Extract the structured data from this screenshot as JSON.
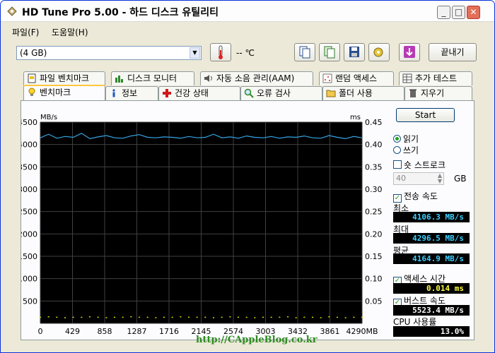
{
  "window": {
    "title": "HD Tune Pro 5.00 - 하드 디스크 유틸리티"
  },
  "menu": [
    {
      "label": "파일(F)"
    },
    {
      "label": "도움말(H)"
    }
  ],
  "toolbar": {
    "drive_value": "(4 GB)",
    "temperature": "-- ℃",
    "exit_label": "끝내기"
  },
  "tabs_top": [
    {
      "label": "파일 벤치마크"
    },
    {
      "label": "디스크 모니터"
    },
    {
      "label": "자동 소음 관리(AAM)"
    },
    {
      "label": "랜덤 액세스"
    },
    {
      "label": "추가 테스트"
    }
  ],
  "tabs_bottom": [
    {
      "label": "벤치마크"
    },
    {
      "label": "정보"
    },
    {
      "label": "건강 상태"
    },
    {
      "label": "오류 검사"
    },
    {
      "label": "폴더 사용"
    },
    {
      "label": "지우기"
    }
  ],
  "controls": {
    "start_label": "Start",
    "read_label": "읽기",
    "write_label": "쓰기",
    "short_stroke_label": "숏 스트로크",
    "short_stroke_value": "40",
    "gb_unit": "GB",
    "transfer_rate_label": "전송 속도",
    "min_label": "최소",
    "min_value": "4106.3 MB/s",
    "max_label": "최대",
    "max_value": "4296.5 MB/s",
    "avg_label": "평균",
    "avg_value": "4164.9 MB/s",
    "access_time_label": "액세스 시간",
    "access_time_value": "0.014 ms",
    "burst_rate_label": "버스트 속도",
    "burst_rate_value": "5523.4 MB/s",
    "cpu_label": "CPU 사용률",
    "cpu_value": "13.0%"
  },
  "colors": {
    "chart_bg": "#000000",
    "grid": "#404040",
    "transfer_line": "#35a5e6",
    "access_points": "#d8d800",
    "readout_cyan": "#3ccfff",
    "readout_yellow": "#ffff40",
    "readout_white": "#ffffff"
  },
  "watermark": "http://CAppleBlog.co.kr",
  "chart_data": {
    "type": "line",
    "left_unit": "MB/s",
    "right_unit": "ms",
    "x_tick_labels": [
      "0",
      "429",
      "858",
      "1287",
      "1716",
      "2145",
      "2574",
      "3003",
      "3432",
      "3861",
      "4290MB"
    ],
    "y_left_ticks": [
      "4500",
      "4000",
      "3500",
      "3000",
      "2500",
      "2000",
      "1500",
      "1000",
      "500"
    ],
    "y_right_ticks": [
      "0.45",
      "0.40",
      "0.35",
      "0.30",
      "0.25",
      "0.20",
      "0.15",
      "0.10",
      "0.05"
    ],
    "xlim": [
      0,
      4290
    ],
    "ylim_left": [
      0,
      4500
    ],
    "ylim_right": [
      0,
      0.45
    ],
    "grid": true,
    "series": [
      {
        "axis": "left",
        "x": [
          0,
          110,
          220,
          330,
          440,
          550,
          660,
          770,
          880,
          990,
          1100,
          1210,
          1320,
          1430,
          1540,
          1650,
          1760,
          1870,
          1980,
          2090,
          2200,
          2310,
          2420,
          2530,
          2640,
          2750,
          2860,
          2970,
          3080,
          3190,
          3300,
          3410,
          3520,
          3630,
          3740,
          3850,
          3960,
          4070,
          4180,
          4290
        ],
        "values": [
          4150,
          4230,
          4140,
          4180,
          4160,
          4250,
          4130,
          4170,
          4200,
          4150,
          4140,
          4190,
          4220,
          4160,
          4150,
          4170,
          4160,
          4140,
          4180,
          4150,
          4160,
          4230,
          4150,
          4170,
          4140,
          4190,
          4160,
          4150,
          4180,
          4140,
          4170,
          4160,
          4190,
          4150,
          4140,
          4200,
          4160,
          4130,
          4180,
          4150
        ]
      },
      {
        "axis": "right",
        "x": [
          0,
          110,
          220,
          330,
          440,
          550,
          660,
          770,
          880,
          990,
          1100,
          1210,
          1320,
          1430,
          1540,
          1650,
          1760,
          1870,
          1980,
          2090,
          2200,
          2310,
          2420,
          2530,
          2640,
          2750,
          2860,
          2970,
          3080,
          3190,
          3300,
          3410,
          3520,
          3630,
          3740,
          3850,
          3960,
          4070,
          4180,
          4290
        ],
        "values": [
          0.014,
          0.015,
          0.014,
          0.013,
          0.014,
          0.014,
          0.015,
          0.014,
          0.013,
          0.014,
          0.014,
          0.015,
          0.014,
          0.014,
          0.013,
          0.014,
          0.014,
          0.015,
          0.014,
          0.014,
          0.014,
          0.013,
          0.014,
          0.015,
          0.014,
          0.014,
          0.013,
          0.014,
          0.014,
          0.014,
          0.015,
          0.013,
          0.014,
          0.014,
          0.013,
          0.015,
          0.014,
          0.013,
          0.014,
          0.014
        ]
      }
    ]
  }
}
